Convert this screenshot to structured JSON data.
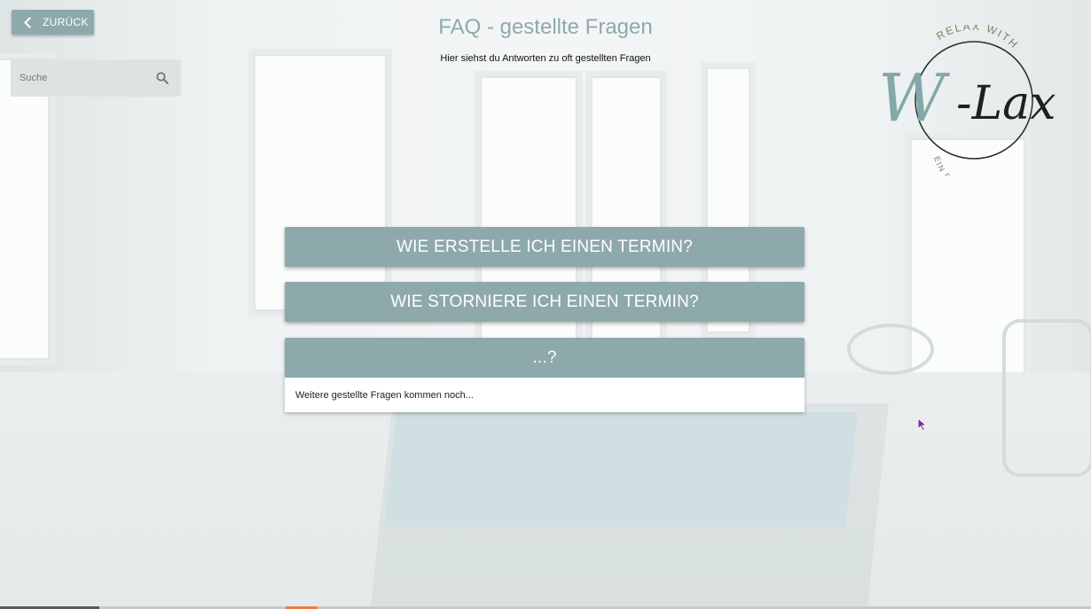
{
  "header": {
    "back_label": "ZURÜCK",
    "title": "FAQ - gestellte Fragen",
    "subtitle": "Hier siehst du Antworten zu oft gestellten Fragen"
  },
  "search": {
    "placeholder": "Suche",
    "icon": "search-icon"
  },
  "logo": {
    "top_text": "RELAX WITH",
    "main_text": "W-Lax",
    "bottom_text": "EIN RAUM FÜR ALLE"
  },
  "faq": {
    "items": [
      {
        "question": "WIE ERSTELLE ICH EINEN TERMIN?",
        "expanded": false
      },
      {
        "question": "WIE STORNIERE ICH EINEN TERMIN?",
        "expanded": false
      },
      {
        "question": "...?",
        "expanded": true,
        "answer": "Weitere gestellte Fragen kommen noch..."
      }
    ]
  },
  "colors": {
    "accent": "#8ea9ac",
    "title": "#8fa9ad",
    "background": "#eef2f2"
  }
}
